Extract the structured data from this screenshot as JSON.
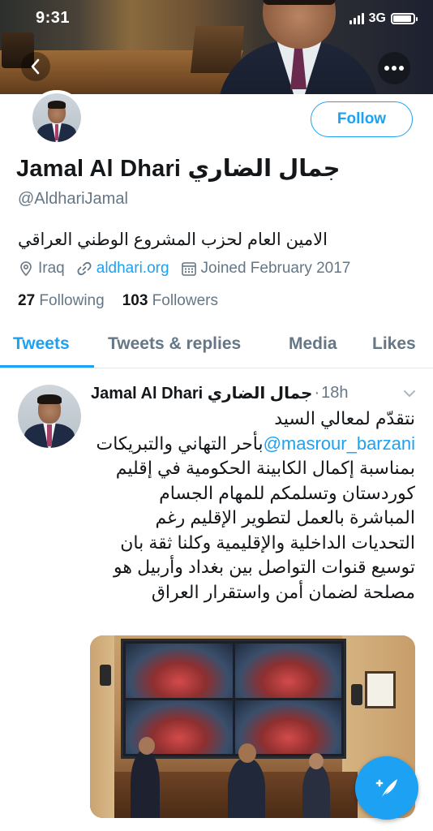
{
  "status_bar": {
    "time": "9:31",
    "network": "3G",
    "battery_level": 0.9
  },
  "profile": {
    "display_name": "Jamal Al Dhari جمال الضاري",
    "handle": "@AldhariJamal",
    "bio": "الامين العام لحزب المشروع الوطني العراقي",
    "location": "Iraq",
    "website": "aldhari.org",
    "joined": "Joined February 2017",
    "following_count": "27",
    "following_label": "Following",
    "followers_count": "103",
    "followers_label": "Followers",
    "follow_button": "Follow"
  },
  "tabs": [
    {
      "label": "Tweets",
      "active": true
    },
    {
      "label": "Tweets & replies",
      "active": false
    },
    {
      "label": "Media",
      "active": false
    },
    {
      "label": "Likes",
      "active": false
    }
  ],
  "tweet": {
    "author": "Jamal Al Dhari جمال الضاري",
    "time": "18h",
    "text_part1": "نتقدّم لمعالي السيد",
    "mention": "@masrour_barzani",
    "text_part2": "بأحر التهاني والتبريكات بمناسبة إكمال الكابينة الحكومية في إقليم كوردستان وتسلمكم للمهام الجسام المباشرة بالعمل لتطوير الإقليم رغم التحديات الداخلية والإقليمية وكلنا ثقة بان توسيع قنوات التواصل بين بغداد وأربيل هو مصلحة لضمان أمن واستقرار العراق"
  },
  "icons": {
    "back": "chevron-left-icon",
    "more": "more-horizontal-icon",
    "location": "location-pin-icon",
    "link": "link-icon",
    "calendar": "calendar-icon",
    "chevron": "chevron-down-icon",
    "compose": "compose-feather-icon"
  },
  "colors": {
    "accent": "#1da1f2",
    "secondary_text": "#657786",
    "primary_text": "#14171a"
  }
}
